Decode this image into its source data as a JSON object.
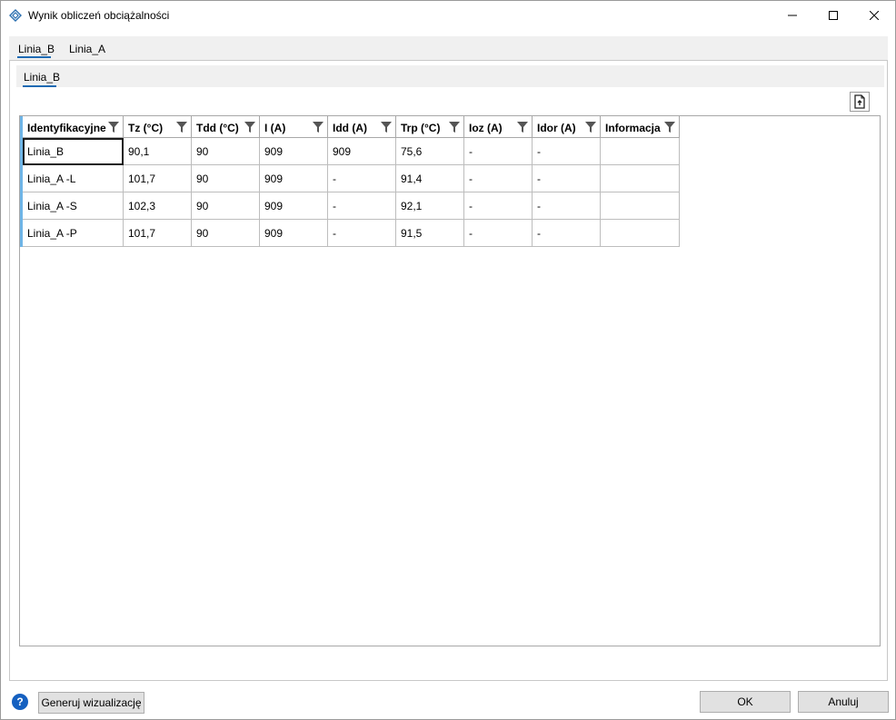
{
  "window": {
    "title": "Wynik obliczeń obciążalności"
  },
  "tabs": [
    {
      "label": "Linia_B",
      "selected": true
    },
    {
      "label": "Linia_A",
      "selected": false
    }
  ],
  "subtabs": [
    {
      "label": "Linia_B",
      "selected": true
    }
  ],
  "table": {
    "columns": [
      "Identyfikacyjne",
      "Tz (°C)",
      "Tdd (°C)",
      "I (A)",
      "Idd (A)",
      "Trp (°C)",
      "Ioz (A)",
      "Idor (A)",
      "Informacja"
    ],
    "rows": [
      [
        "Linia_B",
        "90,1",
        "90",
        "909",
        "909",
        "75,6",
        "-",
        "-",
        ""
      ],
      [
        "Linia_A -L",
        "101,7",
        "90",
        "909",
        "-",
        "91,4",
        "-",
        "-",
        ""
      ],
      [
        "Linia_A -S",
        "102,3",
        "90",
        "909",
        "-",
        "92,1",
        "-",
        "-",
        ""
      ],
      [
        "Linia_A -P",
        "101,7",
        "90",
        "909",
        "-",
        "91,5",
        "-",
        "-",
        ""
      ]
    ]
  },
  "footer": {
    "help_glyph": "?",
    "generate_label": "Generuj wizualizację",
    "ok_label": "OK",
    "cancel_label": "Anuluj"
  },
  "colors": {
    "accent": "#1e6ab3",
    "row_indicator": "#6fb5e7",
    "help": "#1560c0"
  }
}
